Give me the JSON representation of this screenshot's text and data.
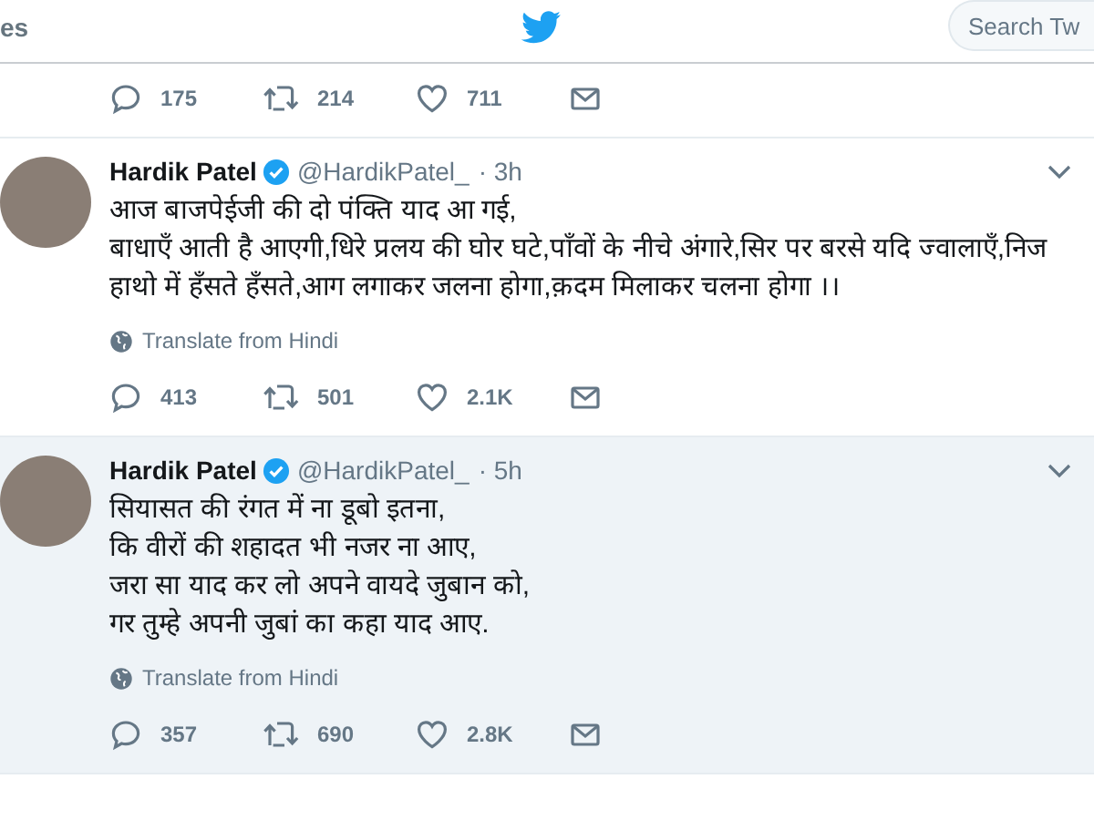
{
  "header": {
    "nav_fragment": "es",
    "search": {
      "placeholder": "Search Tw"
    }
  },
  "previous_tweet_actions": {
    "replies": "175",
    "retweets": "214",
    "likes": "711"
  },
  "tweets": [
    {
      "name": "Hardik Patel",
      "verified": true,
      "handle": "@HardikPatel_",
      "time": "· 3h",
      "hovered": false,
      "text": [
        "आज बाजपेईजी की दो पंक्ति याद आ गई,",
        "बाधाएँ आती है आएगी,धिरे प्रलय की घोर घटे,पाँवों के नीचे अंगारे,सिर पर बरसे यदि ज्वालाएँ,निज हाथो में हँसते हँसते,आग लगाकर जलना होगा,क़दम मिलाकर चलना होगा ।।"
      ],
      "translate": "Translate from Hindi",
      "replies": "413",
      "retweets": "501",
      "likes": "2.1K"
    },
    {
      "name": "Hardik Patel",
      "verified": true,
      "handle": "@HardikPatel_",
      "time": "· 5h",
      "hovered": true,
      "text": [
        "सियासत की रंगत में ना डूबो इतना,",
        "कि वीरों की शहादत भी नजर ना आए,",
        "जरा सा याद कर लो अपने वायदे जुबान को,",
        "गर तुम्हे अपनी जुबां का कहा याद आए."
      ],
      "translate": "Translate from Hindi",
      "replies": "357",
      "retweets": "690",
      "likes": "2.8K"
    }
  ]
}
